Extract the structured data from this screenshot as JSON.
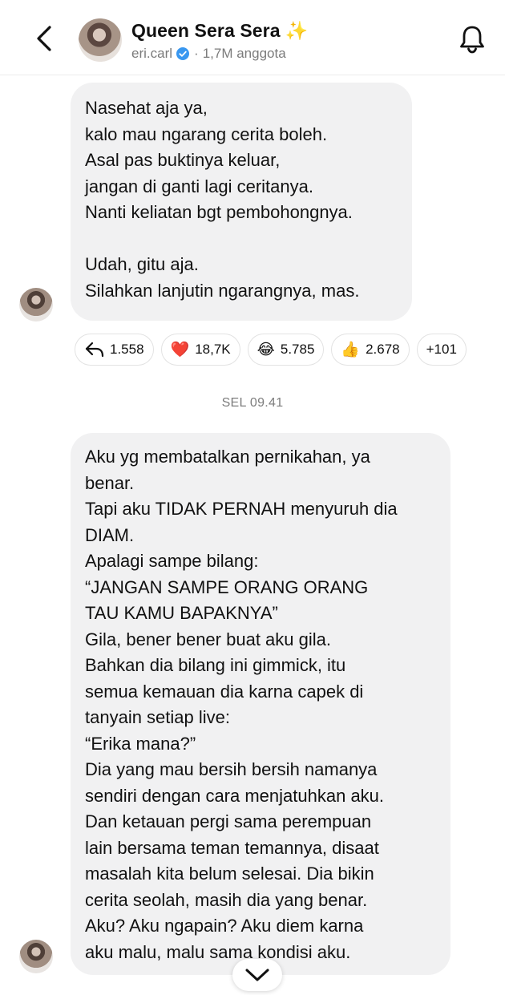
{
  "header": {
    "title": "Queen Sera Sera",
    "title_emoji": "✨",
    "owner": "eri.carl",
    "members": "1,7M anggota"
  },
  "messages": [
    {
      "text": "Nasehat aja ya,\nkalo mau ngarang cerita boleh.\nAsal pas buktinya keluar,\njangan di ganti lagi ceritanya.\nNanti keliatan bgt pembohongnya.\n\nUdah, gitu aja.\nSilahkan lanjutin ngarangnya, mas.",
      "reactions": [
        {
          "icon": "reply-icon",
          "emoji": "",
          "count": "1.558"
        },
        {
          "icon": "heart-icon",
          "emoji": "❤️",
          "count": "18,7K"
        },
        {
          "icon": "laughing-icon",
          "emoji": "😂",
          "count": "5.785"
        },
        {
          "icon": "thumbs-up-icon",
          "emoji": "👍",
          "count": "2.678"
        },
        {
          "icon": "",
          "emoji": "",
          "count": "+101"
        }
      ]
    },
    {
      "text": "Aku yg membatalkan pernikahan, ya\nbenar.\nTapi aku TIDAK PERNAH menyuruh dia\nDIAM.\nApalagi sampe bilang:\n “JANGAN SAMPE ORANG ORANG\nTAU KAMU BAPAKNYA”\nGila, bener bener buat aku gila.\nBahkan dia bilang ini gimmick, itu\nsemua kemauan dia karna capek di\ntanyain setiap live:\n“Erika mana?”\nDia yang mau bersih bersih namanya\nsendiri dengan cara menjatuhkan aku.\nDan ketauan pergi sama perempuan\nlain bersama teman temannya, disaat\nmasalah kita belum selesai. Dia bikin\ncerita seolah, masih dia yang benar.\nAku? Aku ngapain? Aku diem karna\naku malu, malu sama kondisi aku."
    }
  ],
  "timestamp": "SEL 09.41",
  "colors": {
    "bubble": "#f1f1f2",
    "verified": "#3897f0",
    "muted_text": "#7b7b7b"
  }
}
